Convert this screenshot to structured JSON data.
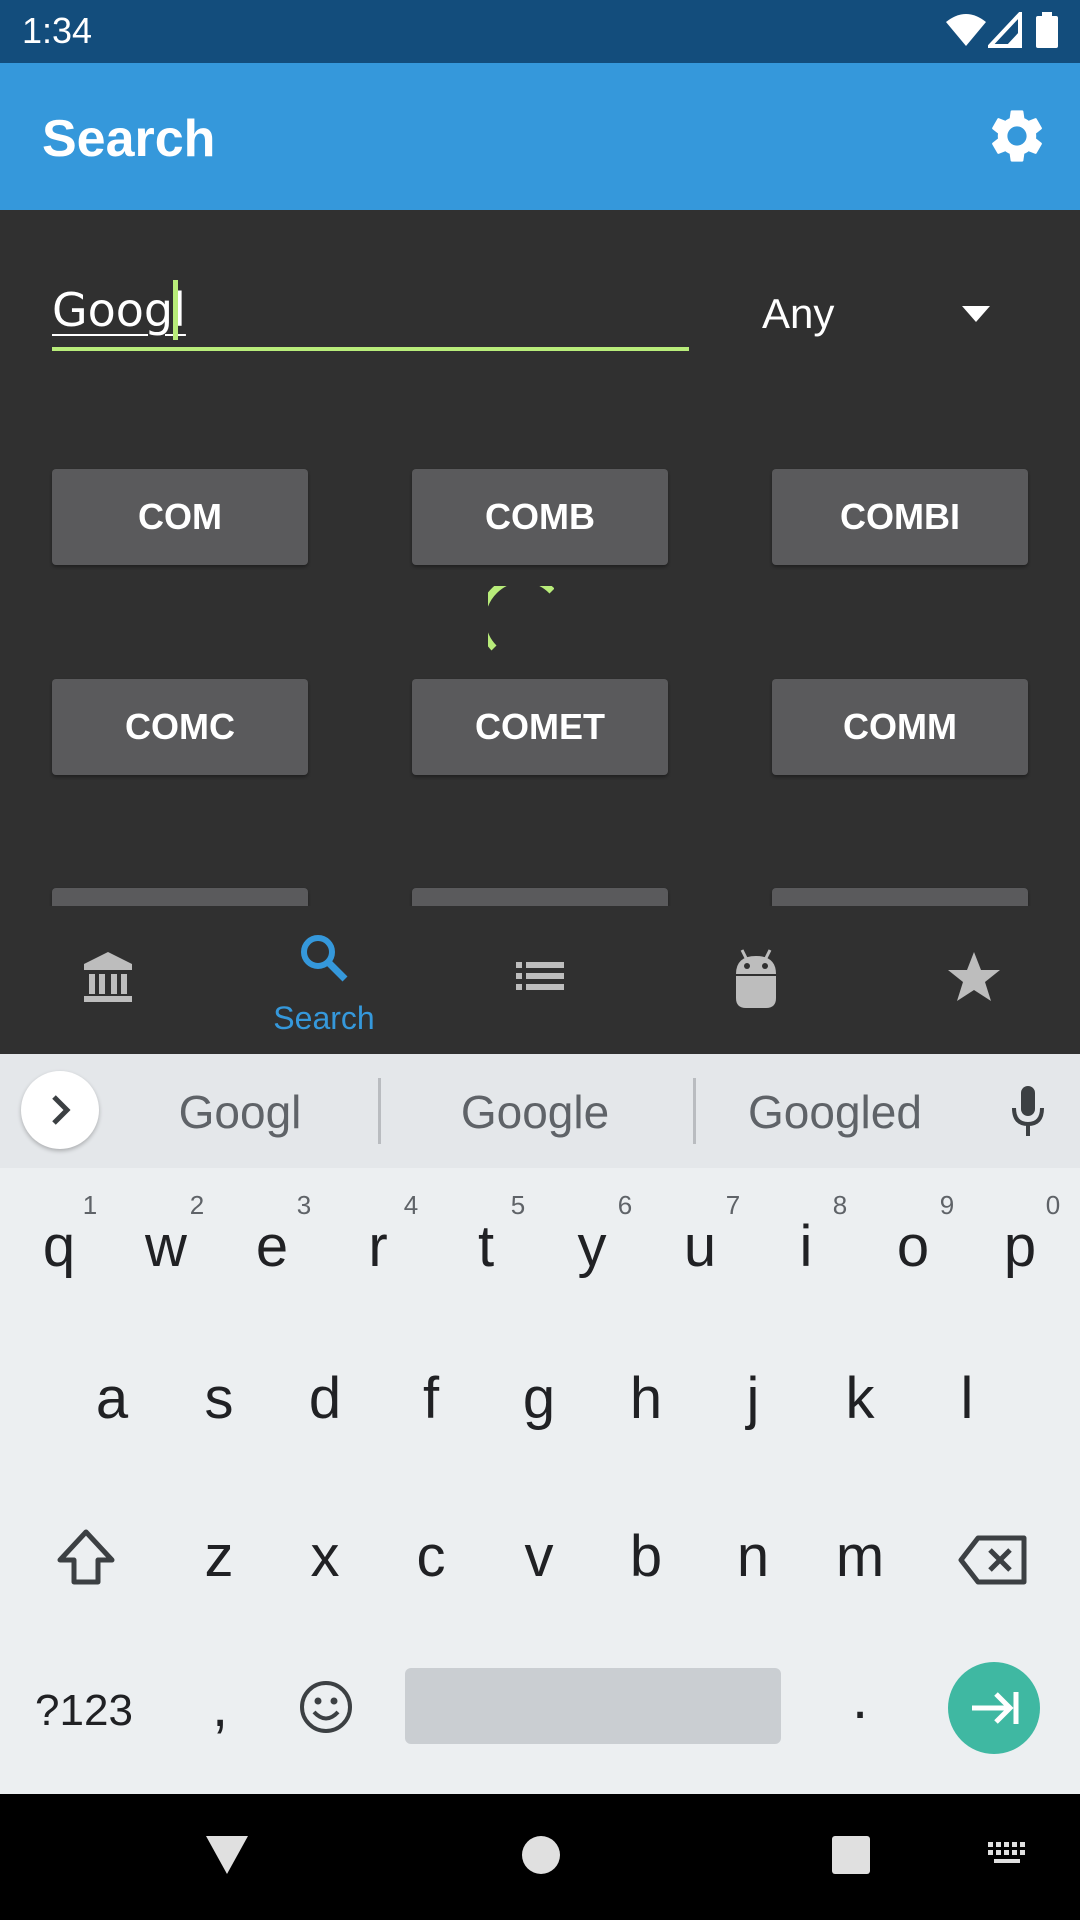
{
  "status_bar": {
    "time": "1:34"
  },
  "app_bar": {
    "title": "Search"
  },
  "search": {
    "value": "Googl",
    "placeholder": ""
  },
  "type_filter": {
    "selected": "Any"
  },
  "results": [
    [
      "COM",
      "COMB",
      "COMBI"
    ],
    [
      "COMC",
      "COMET",
      "COMM"
    ]
  ],
  "bottom_nav": {
    "items": [
      {
        "icon": "bank-icon",
        "label": ""
      },
      {
        "icon": "search-icon",
        "label": "Search",
        "active": true
      },
      {
        "icon": "list-icon",
        "label": ""
      },
      {
        "icon": "android-icon",
        "label": ""
      },
      {
        "icon": "star-icon",
        "label": ""
      }
    ],
    "active_color": "#3598db"
  },
  "keyboard": {
    "suggestions": [
      "Googl",
      "Google",
      "Googled"
    ],
    "row1": [
      "q",
      "w",
      "e",
      "r",
      "t",
      "y",
      "u",
      "i",
      "o",
      "p"
    ],
    "row1_hints": [
      "1",
      "2",
      "3",
      "4",
      "5",
      "6",
      "7",
      "8",
      "9",
      "0"
    ],
    "row2": [
      "a",
      "s",
      "d",
      "f",
      "g",
      "h",
      "j",
      "k",
      "l"
    ],
    "row3": [
      "z",
      "x",
      "c",
      "v",
      "b",
      "n",
      "m"
    ],
    "symbols_key": "?123",
    "comma_key": ",",
    "period_key": "."
  },
  "colors": {
    "accent": "#b8ec7a",
    "app_bar": "#3598db",
    "status_bar": "#134d7c",
    "enter": "#3fb8a2"
  }
}
